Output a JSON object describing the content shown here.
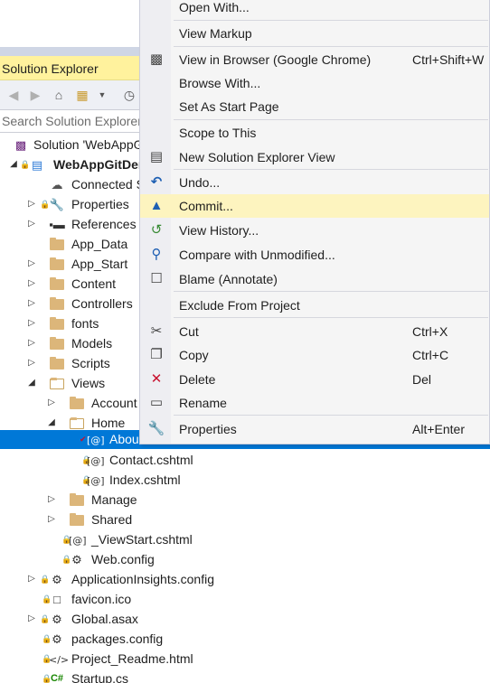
{
  "solution_explorer": {
    "title": "Solution Explorer",
    "search_placeholder": "Search Solution Explorer",
    "toolbar_icons": [
      "back-icon",
      "forward-icon",
      "home-icon",
      "switch-views-icon",
      "dropdown-icon",
      "pending-changes-icon"
    ],
    "tree": [
      {
        "label": "Solution 'WebAppGitDemo'",
        "icon": "solution-icon"
      },
      {
        "label": "WebAppGitDemo",
        "icon": "web-project-icon"
      },
      {
        "label": "Connected Services",
        "icon": "connected-services-icon"
      },
      {
        "label": "Properties",
        "icon": "wrench-icon"
      },
      {
        "label": "References",
        "icon": "references-icon"
      },
      {
        "label": "App_Data",
        "icon": "folder-icon"
      },
      {
        "label": "App_Start",
        "icon": "folder-icon"
      },
      {
        "label": "Content",
        "icon": "folder-icon"
      },
      {
        "label": "Controllers",
        "icon": "folder-icon"
      },
      {
        "label": "fonts",
        "icon": "folder-icon"
      },
      {
        "label": "Models",
        "icon": "folder-icon"
      },
      {
        "label": "Scripts",
        "icon": "folder-icon"
      },
      {
        "label": "Views",
        "icon": "folder-open-icon"
      },
      {
        "label": "Account",
        "icon": "folder-icon"
      },
      {
        "label": "Home",
        "icon": "folder-open-icon"
      },
      {
        "label": "About.cshtml",
        "icon": "razor-file-icon"
      },
      {
        "label": "Contact.cshtml",
        "icon": "razor-file-icon"
      },
      {
        "label": "Index.cshtml",
        "icon": "razor-file-icon"
      },
      {
        "label": "Manage",
        "icon": "folder-icon"
      },
      {
        "label": "Shared",
        "icon": "folder-icon"
      },
      {
        "label": "_ViewStart.cshtml",
        "icon": "razor-file-icon"
      },
      {
        "label": "Web.config",
        "icon": "config-icon"
      },
      {
        "label": "ApplicationInsights.config",
        "icon": "config-icon"
      },
      {
        "label": "favicon.ico",
        "icon": "ico-file-icon"
      },
      {
        "label": "Global.asax",
        "icon": "asax-icon"
      },
      {
        "label": "packages.config",
        "icon": "config-icon"
      },
      {
        "label": "Project_Readme.html",
        "icon": "html-file-icon"
      },
      {
        "label": "Startup.cs",
        "icon": "csharp-file-icon"
      }
    ]
  },
  "context_menu": {
    "items": [
      {
        "label": "Open With...",
        "shortcut": "",
        "icon": ""
      },
      {
        "label": "View Markup",
        "shortcut": "",
        "icon": ""
      },
      {
        "label": "View in Browser (Google Chrome)",
        "shortcut": "Ctrl+Shift+W",
        "icon": "browser-icon"
      },
      {
        "label": "Browse With...",
        "shortcut": "",
        "icon": ""
      },
      {
        "label": "Set As Start Page",
        "shortcut": "",
        "icon": ""
      },
      {
        "label": "Scope to This",
        "shortcut": "",
        "icon": ""
      },
      {
        "label": "New Solution Explorer View",
        "shortcut": "",
        "icon": "new-view-icon"
      },
      {
        "label": "Undo...",
        "shortcut": "",
        "icon": "undo-icon"
      },
      {
        "label": "Commit...",
        "shortcut": "",
        "icon": "commit-icon"
      },
      {
        "label": "View History...",
        "shortcut": "",
        "icon": "history-icon"
      },
      {
        "label": "Compare with Unmodified...",
        "shortcut": "",
        "icon": "compare-icon"
      },
      {
        "label": "Blame (Annotate)",
        "shortcut": "",
        "icon": "blame-icon"
      },
      {
        "label": "Exclude From Project",
        "shortcut": "",
        "icon": ""
      },
      {
        "label": "Cut",
        "shortcut": "Ctrl+X",
        "icon": "scissors-icon"
      },
      {
        "label": "Copy",
        "shortcut": "Ctrl+C",
        "icon": "copy-icon"
      },
      {
        "label": "Delete",
        "shortcut": "Del",
        "icon": "delete-icon"
      },
      {
        "label": "Rename",
        "shortcut": "",
        "icon": "rename-icon"
      },
      {
        "label": "Properties",
        "shortcut": "Alt+Enter",
        "icon": "wrench-icon"
      }
    ]
  },
  "colors": {
    "title_bar": "#fff29d",
    "selection": "#0078d7",
    "menu_highlight": "#fdf4bf",
    "lock_badge": "#1c97ea"
  }
}
